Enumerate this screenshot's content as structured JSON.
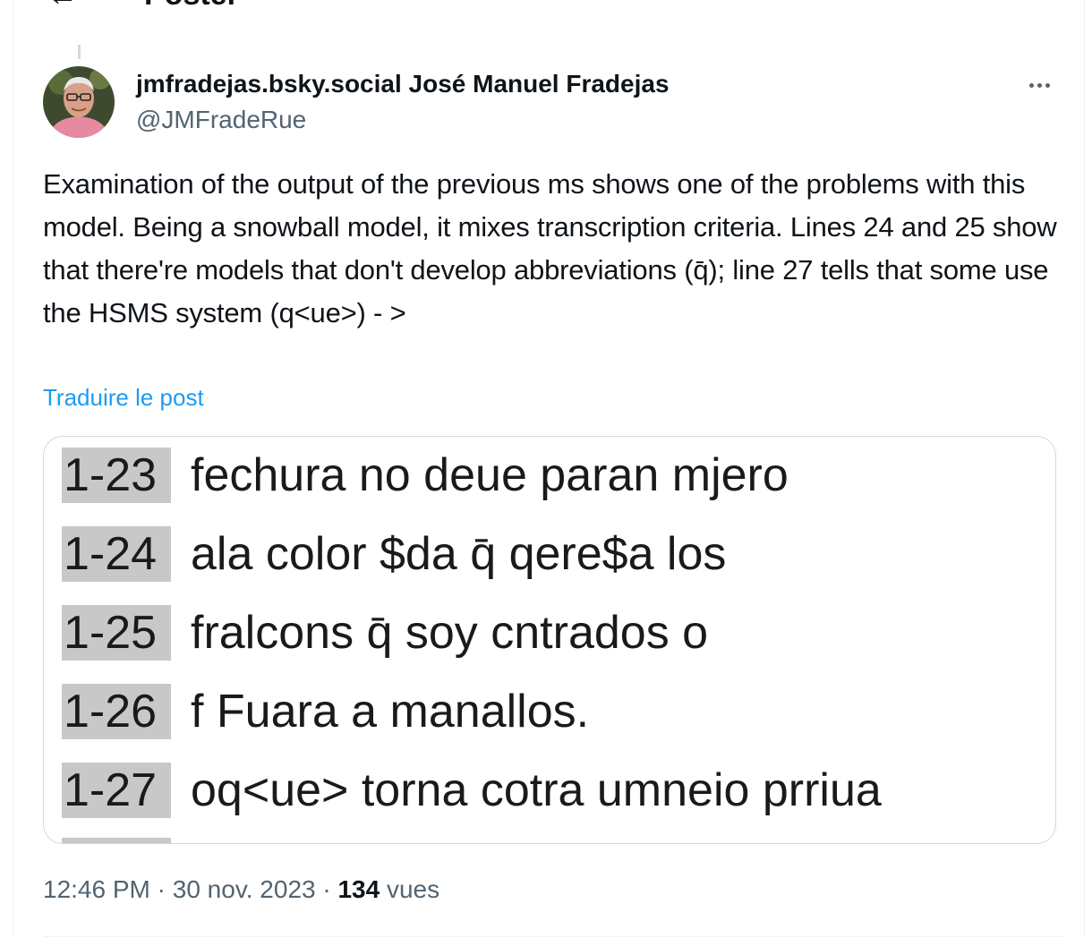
{
  "header": {
    "back_icon": "arrow-left-icon",
    "title": "Poster"
  },
  "post": {
    "author_name": "jmfradejas.bsky.social José Manuel Fradejas",
    "author_handle": "@JMFradeRue",
    "more_icon": "more-horizontal-icon",
    "text": "Examination of the output of the previous ms shows one of the problems with this model. Being a snowball model, it mixes transcription criteria. Lines 24 and 25 show that there're models that don't develop abbreviations (q̄); line 27 tells that some use the HSMS system (q<ue>) - >",
    "translate_label": "Traduire le post",
    "image_lines": [
      {
        "no": "1-23",
        "text": "fechura no deue paran mjero"
      },
      {
        "no": "1-24",
        "text": "ala color $da q̄ qere$a los"
      },
      {
        "no": "1-25",
        "text": "fralcons q̄ soy cntrados o"
      },
      {
        "no": "1-26",
        "text": "f Fuara a manallos."
      },
      {
        "no": "1-27",
        "text": "oq<ue> torna cotra umneio prriua"
      }
    ],
    "time": "12:46 PM",
    "date": "30 nov. 2023",
    "separator": "·",
    "views_count": "134",
    "views_label": "vues"
  },
  "colors": {
    "link": "#1d9bf0",
    "secondary_text": "#536471",
    "line_number_highlight": "#c8c8c8"
  }
}
